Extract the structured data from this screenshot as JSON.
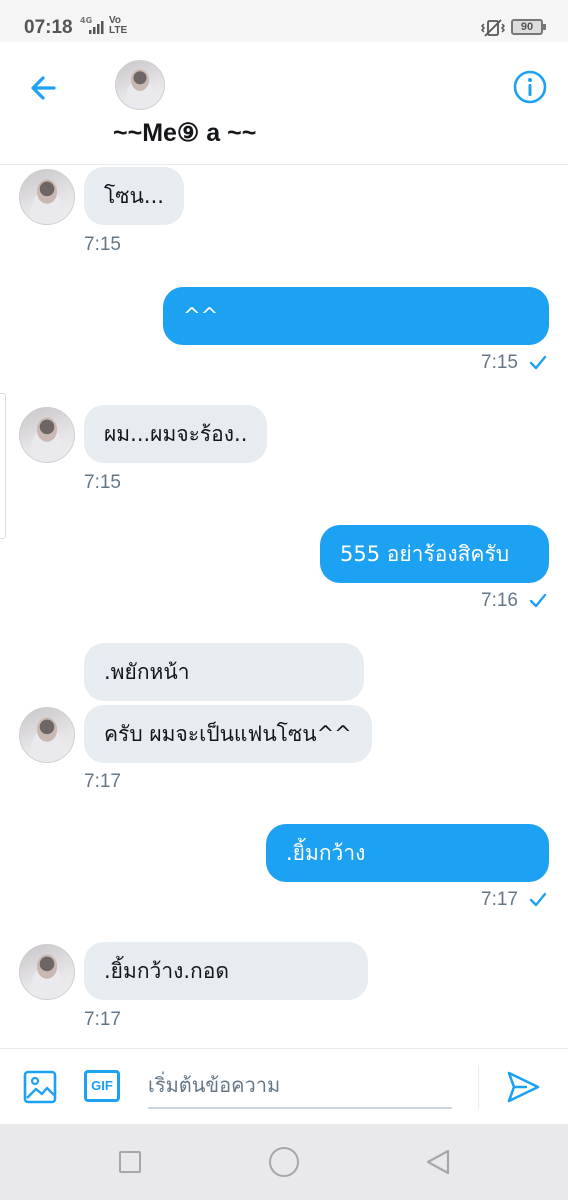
{
  "status_bar": {
    "time": "07:18",
    "network": "4G",
    "volte": "Vo\nLTE",
    "battery": "90"
  },
  "header": {
    "title": "~~Me⑨ a ~~",
    "back_icon": "arrow-left-icon",
    "info_icon": "info-circle-icon"
  },
  "messages": [
    {
      "direction": "received",
      "text": "โซน...",
      "time": "7:15"
    },
    {
      "direction": "sent",
      "text": "^^",
      "time": "7:15"
    },
    {
      "direction": "received",
      "text": "ผม...ผมจะร้อง..",
      "time": "7:15"
    },
    {
      "direction": "sent",
      "text": "555 อย่าร้องสิครับ",
      "time": "7:16"
    },
    {
      "direction": "received",
      "text": ".พยักหน้า",
      "time": ""
    },
    {
      "direction": "received",
      "text": "ครับ ผมจะเป็นแฟนโซน^^",
      "time": "7:17"
    },
    {
      "direction": "sent",
      "text": ".ยิ้มกว้าง",
      "time": "7:17"
    },
    {
      "direction": "received",
      "text": ".ยิ้มกว้าง.กอด",
      "time": "7:17"
    }
  ],
  "composer": {
    "placeholder": "เริ่มต้นข้อความ",
    "gif_label": "GIF",
    "media_icon": "image-icon",
    "send_icon": "send-icon"
  },
  "colors": {
    "accent": "#1da1f2",
    "received_bubble": "#e6ecf0",
    "timestamp": "#657786"
  }
}
